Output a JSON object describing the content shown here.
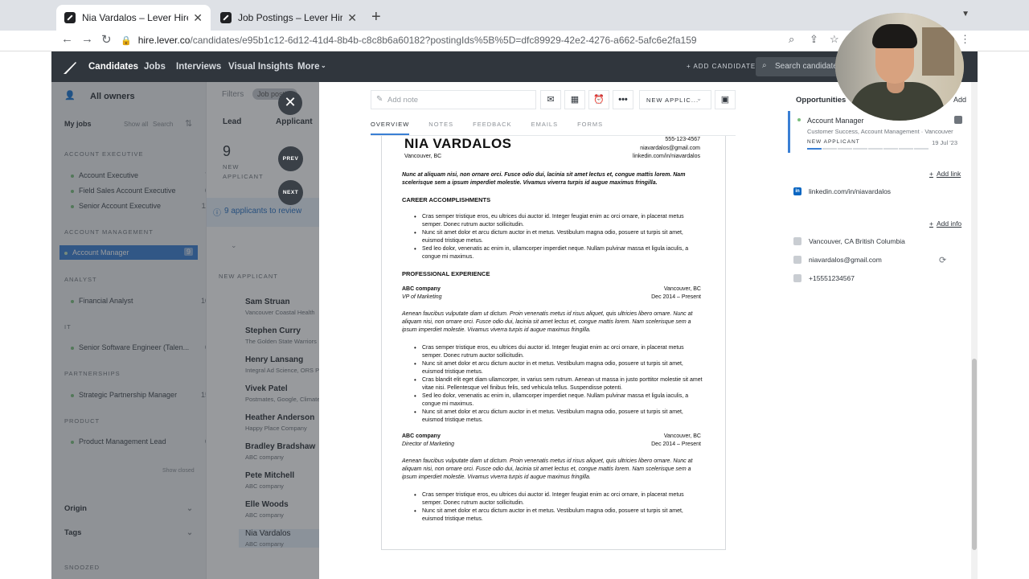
{
  "browser": {
    "tabs": [
      {
        "title": "Nia Vardalos – Lever Hire",
        "active": true
      },
      {
        "title": "Job Postings – Lever Hire",
        "active": false
      }
    ],
    "url_host": "hire.lever.co",
    "url_path": "/candidates/e95b1c12-6d12-41d4-8b4b-c8c8b6a60182?postingIds%5B%5D=dfc89929-42e2-4276-a662-5afc6e2fa159"
  },
  "appnav": {
    "links": [
      "Candidates",
      "Jobs",
      "Interviews",
      "Visual Insights",
      "More"
    ],
    "add_candidate": "+ ADD CANDIDATE",
    "search_placeholder": "Search candidates"
  },
  "sidebar": {
    "owners": "All owners",
    "filters": "Filters",
    "filter_pill": "Job posti...",
    "my_jobs": "My jobs",
    "show_all": "Show all",
    "search": "Search",
    "groups": [
      {
        "name": "ACCOUNT EXECUTIVE",
        "items": [
          {
            "label": "Account Executive",
            "count": "7"
          },
          {
            "label": "Field Sales Account Executive",
            "count": "0"
          },
          {
            "label": "Senior Account Executive",
            "count": "11"
          }
        ]
      },
      {
        "name": "ACCOUNT MANAGEMENT",
        "items": [
          {
            "label": "Account Manager",
            "count": "9",
            "selected": true
          }
        ]
      },
      {
        "name": "ANALYST",
        "items": [
          {
            "label": "Financial Analyst",
            "count": "10"
          }
        ]
      },
      {
        "name": "IT",
        "items": [
          {
            "label": "Senior Software Engineer (Talen...",
            "count": "0"
          }
        ]
      },
      {
        "name": "PARTNERSHIPS",
        "items": [
          {
            "label": "Strategic Partnership Manager",
            "count": "15"
          }
        ]
      },
      {
        "name": "PRODUCT",
        "items": [
          {
            "label": "Product Management Lead",
            "count": "0"
          }
        ]
      }
    ],
    "show_closed": "Show closed",
    "origin": "Origin",
    "tags": "Tags",
    "snoozed": "SNOOZED"
  },
  "listcol": {
    "lead": "Lead",
    "applicant": "Applicant",
    "count": "9",
    "new_applicant": "NEW APPLICANT",
    "review": "9 applicants to review",
    "section": "NEW APPLICANT",
    "candidates": [
      {
        "name": "Sam Struan",
        "company": "Vancouver Coastal Health"
      },
      {
        "name": "Stephen Curry",
        "company": "The Golden State Warriors"
      },
      {
        "name": "Henry Lansang",
        "company": "Integral Ad Science, ORS Part..."
      },
      {
        "name": "Vivek Patel",
        "company": "Postmates, Google, Climate ..."
      },
      {
        "name": "Heather Anderson",
        "company": "Happy Place Company"
      },
      {
        "name": "Bradley Bradshaw",
        "company": "ABC company"
      },
      {
        "name": "Pete Mitchell",
        "company": "ABC company"
      },
      {
        "name": "Elle Woods",
        "company": "ABC company"
      },
      {
        "name": "Nia Vardalos",
        "company": "ABC company"
      }
    ],
    "prev": "PREV",
    "next": "NEXT"
  },
  "panel": {
    "add_note": "Add note",
    "stage": "NEW APPLIC...",
    "tabs": [
      "OVERVIEW",
      "NOTES",
      "FEEDBACK",
      "EMAILS",
      "FORMS"
    ]
  },
  "resume": {
    "name": "NIA VARDALOS",
    "location": "Vancouver, BC",
    "phone": "555-123-4567",
    "email": "niavardalos@gmail.com",
    "linkedin": "linkedin.com/in/niavardalos",
    "summary": "Nunc at aliquam nisi, non ornare orci. Fusce odio dui, lacinia sit amet lectus et, congue mattis lorem. Nam scelerisque sem a ipsum imperdiet molestie. Vivamus viverra turpis id augue maximus fringilla.",
    "accomplishments_title": "CAREER ACCOMPLISHMENTS",
    "accomplishments": [
      "Cras semper tristique eros, eu ultrices dui auctor id. Integer feugiat enim ac orci ornare, in placerat metus semper. Donec rutrum auctor sollicitudin.",
      "Nunc sit amet dolor et arcu dictum auctor in et metus. Vestibulum magna odio, posuere ut turpis sit amet, euismod tristique metus.",
      "Sed leo dolor, venenatis ac enim in, ullamcorper imperdiet neque. Nullam pulvinar massa et ligula iaculis, a congue mi maximus."
    ],
    "experience_title": "PROFESSIONAL EXPERIENCE",
    "jobs": [
      {
        "company": "ABC company",
        "place": "Vancouver, BC",
        "role": "VP of Marketing",
        "dates": "Dec 2014 – Present",
        "desc": "Aenean faucibus vulputate diam ut dictum. Proin venenatis metus id risus aliquet, quis ultricies libero ornare. Nunc at aliquam nisi, non ornare orci. Fusce odio dui, lacinia sit amet lectus et, congue mattis lorem. Nam scelerisque sem a ipsum imperdiet molestie. Vivamus viverra turpis id augue maximus fringilla.",
        "bullets": [
          "Cras semper tristique eros, eu ultrices dui auctor id. Integer feugiat enim ac orci ornare, in placerat metus semper. Donec rutrum auctor sollicitudin.",
          "Nunc sit amet dolor et arcu dictum auctor in et metus. Vestibulum magna odio, posuere ut turpis sit amet, euismod tristique metus.",
          "Cras blandit elit eget diam ullamcorper, in varius sem rutrum. Aenean ut massa in justo porttitor molestie sit amet vitae nisi. Pellentesque vel finibus felis, sed vehicula tellus. Suspendisse potenti.",
          "Sed leo dolor, venenatis ac enim in, ullamcorper imperdiet neque. Nullam pulvinar massa et ligula iaculis, a congue mi maximus.",
          "Nunc sit amet dolor et arcu dictum auctor in et metus. Vestibulum magna odio, posuere ut turpis sit amet, euismod tristique metus."
        ]
      },
      {
        "company": "ABC company",
        "place": "Vancouver, BC",
        "role": "Director of Marketing",
        "dates": "Dec 2014 – Present",
        "desc": "Aenean faucibus vulputate diam ut dictum. Proin venenatis metus id risus aliquet, quis ultricies libero ornare. Nunc at aliquam nisi, non ornare orci. Fusce odio dui, lacinia sit amet lectus et, congue mattis lorem. Nam scelerisque sem a ipsum imperdiet molestie. Vivamus viverra turpis id augue maximus fringilla.",
        "bullets": [
          "Cras semper tristique eros, eu ultrices dui auctor id. Integer feugiat enim ac orci ornare, in placerat metus semper. Donec rutrum auctor sollicitudin.",
          "Nunc sit amet dolor et arcu dictum auctor in et metus. Vestibulum magna odio, posuere ut turpis sit amet, euismod tristique metus."
        ]
      }
    ]
  },
  "right": {
    "opportunities": "Opportunities",
    "add": "Add",
    "opp_title": "Account Manager",
    "opp_sub": "Customer Success, Account Management · Vancouver",
    "opp_stage": "NEW APPLICANT",
    "opp_date": "19 Jul '23",
    "add_link": "Add link",
    "linkedin": "linkedin.com/in/niavardalos",
    "add_info": "Add info",
    "location": "Vancouver, CA British Columbia",
    "email": "niavardalos@gmail.com",
    "phone": "+15551234567"
  },
  "colors": {
    "accent": "#3a7fd4",
    "nav_bg": "#30363d"
  }
}
